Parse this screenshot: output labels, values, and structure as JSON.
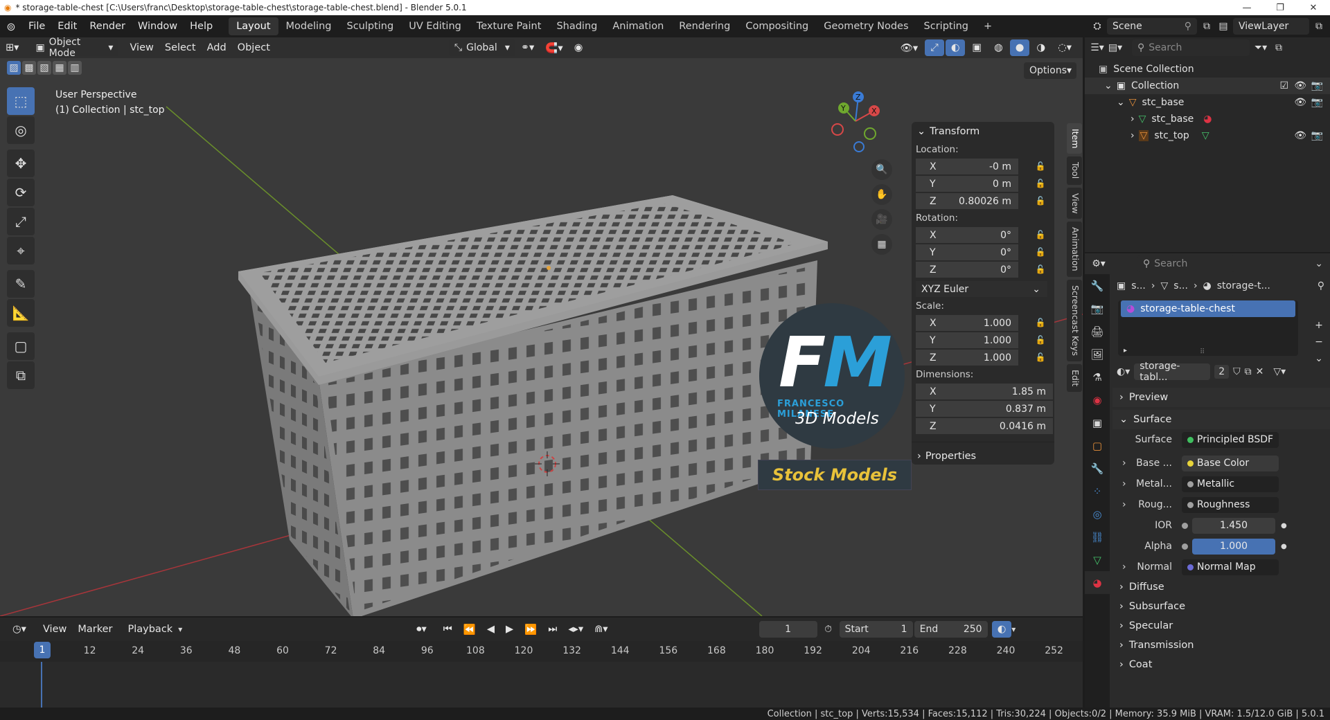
{
  "window": {
    "title": "* storage-table-chest [C:\\Users\\franc\\Desktop\\storage-table-chest\\storage-table-chest.blend] - Blender 5.0.1",
    "controls": [
      "—",
      "❐",
      "✕"
    ]
  },
  "menubar": {
    "menus": [
      "File",
      "Edit",
      "Render",
      "Window",
      "Help"
    ],
    "workspaces": [
      "Layout",
      "Modeling",
      "Sculpting",
      "UV Editing",
      "Texture Paint",
      "Shading",
      "Animation",
      "Rendering",
      "Compositing",
      "Geometry Nodes",
      "Scripting"
    ],
    "active_workspace": "Layout",
    "add_tab": "+",
    "scene": "Scene",
    "view_layer": "ViewLayer"
  },
  "viewport_header": {
    "mode": "Object Mode",
    "menus": [
      "View",
      "Select",
      "Add",
      "Object"
    ],
    "transform_orientation": "Global",
    "options": "Options"
  },
  "viewport": {
    "perspective": "User Perspective",
    "context": "(1) Collection | stc_top",
    "gizmo_axes": [
      "X",
      "Y",
      "Z"
    ],
    "background": "#3a3a3a",
    "x_axis_color": "#c4383d",
    "y_axis_color": "#6d9c2a"
  },
  "watermark": {
    "logo_text": "FM",
    "name": "FRANCESCO MILANESE",
    "subtitle": "3D Models",
    "badge": "Stock Models"
  },
  "npanel": {
    "section": "Transform",
    "location_label": "Location:",
    "location": [
      [
        "X",
        "-0 m"
      ],
      [
        "Y",
        "0 m"
      ],
      [
        "Z",
        "0.80026 m"
      ]
    ],
    "rotation_label": "Rotation:",
    "rotation": [
      [
        "X",
        "0°"
      ],
      [
        "Y",
        "0°"
      ],
      [
        "Z",
        "0°"
      ]
    ],
    "rotation_mode": "XYZ Euler",
    "scale_label": "Scale:",
    "scale": [
      [
        "X",
        "1.000"
      ],
      [
        "Y",
        "1.000"
      ],
      [
        "Z",
        "1.000"
      ]
    ],
    "dimensions_label": "Dimensions:",
    "dimensions": [
      [
        "X",
        "1.85 m"
      ],
      [
        "Y",
        "0.837 m"
      ],
      [
        "Z",
        "0.0416 m"
      ]
    ],
    "properties": "Properties",
    "tabs": [
      "Item",
      "Tool",
      "View",
      "Animation",
      "Screencast Keys",
      "Edit"
    ]
  },
  "outliner": {
    "search_placeholder": "Search",
    "items": [
      {
        "label": "Scene Collection",
        "indent": 0
      },
      {
        "label": "Collection",
        "indent": 1
      },
      {
        "label": "stc_base",
        "indent": 2
      },
      {
        "label": "stc_base",
        "indent": 3
      },
      {
        "label": "stc_top",
        "indent": 3
      }
    ]
  },
  "properties": {
    "search_placeholder": "Search",
    "breadcrumb": [
      "s...",
      "s...",
      "storage-t..."
    ],
    "material_slot": "storage-table-chest",
    "material_name": "storage-tabl...",
    "users": "2",
    "sections": {
      "preview": "Preview",
      "surface": "Surface"
    },
    "rows": [
      {
        "label": "Surface",
        "value": "Principled BSDF",
        "dot": "#3fbf5f",
        "expand": false
      },
      {
        "label": "Base ...",
        "value": "Base Color",
        "dot": "#e8d43a",
        "expand": true
      },
      {
        "label": "Metal...",
        "value": "Metallic",
        "dot": "#a0a0a0",
        "expand": true
      },
      {
        "label": "Roug...",
        "value": "Roughness",
        "dot": "#a0a0a0",
        "expand": true
      },
      {
        "label": "IOR",
        "value": "1.450",
        "dot": "#a0a0a0",
        "expand": false
      },
      {
        "label": "Alpha",
        "value": "1.000",
        "dot": "#a0a0a0",
        "expand": false
      },
      {
        "label": "Normal",
        "value": "Normal Map",
        "dot": "#6b6bd6",
        "expand": true
      }
    ],
    "subsections": [
      "Diffuse",
      "Subsurface",
      "Specular",
      "Transmission",
      "Coat"
    ]
  },
  "timeline": {
    "menus": [
      "View",
      "Marker",
      "Playback"
    ],
    "current_frame": "1",
    "start_label": "Start",
    "start": "1",
    "end_label": "End",
    "end": "250",
    "ticks": [
      "1",
      "12",
      "24",
      "36",
      "48",
      "60",
      "72",
      "84",
      "96",
      "108",
      "120",
      "132",
      "144",
      "156",
      "168",
      "180",
      "192",
      "204",
      "216",
      "228",
      "240",
      "252"
    ]
  },
  "statusbar": {
    "text": "Collection | stc_top | Verts:15,534 | Faces:15,112 | Tris:30,224 | Objects:0/2 | Memory: 35.9 MiB | VRAM: 1.5/12.0 GiB | 5.0.1"
  }
}
